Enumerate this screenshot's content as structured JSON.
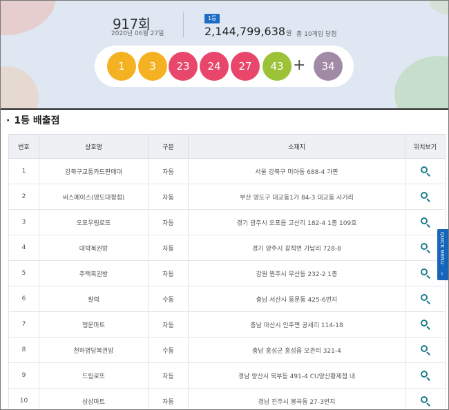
{
  "draw": {
    "round": "917회",
    "date": "2020년 06월 27일",
    "rank_badge": "1등",
    "prize_amount": "2,144,799,638",
    "prize_unit": "원",
    "winner_summary": "총 10게임 당첨",
    "numbers": [
      "1",
      "3",
      "23",
      "24",
      "27",
      "43"
    ],
    "plus": "+",
    "bonus": "34",
    "ball_colors": [
      "#f4b223",
      "#f4b223",
      "#e8466a",
      "#e8466a",
      "#e8466a",
      "#9cc238"
    ],
    "bonus_color": "#a08aa6"
  },
  "section": {
    "bullet": "·",
    "title": "1등 배출점"
  },
  "table": {
    "headers": [
      "번호",
      "상호명",
      "구분",
      "소재지",
      "위치보기"
    ],
    "rows": [
      {
        "no": "1",
        "name": "강북구교통카드판매대",
        "type": "자동",
        "address": "서울 강북구 미아동 688-4 가판"
      },
      {
        "no": "2",
        "name": "씨스페이스(영도대평점)",
        "type": "자동",
        "address": "부산 영도구 대교동1가 84-3 대교동 사거리"
      },
      {
        "no": "3",
        "name": "오포우림로또",
        "type": "자동",
        "address": "경기 광주시 오포읍 고산리 182-4 1층 109호"
      },
      {
        "no": "4",
        "name": "대박복권방",
        "type": "자동",
        "address": "경기 양주시 광적면 가납리 728-8"
      },
      {
        "no": "5",
        "name": "주택복권방",
        "type": "자동",
        "address": "강원 원주시 우산동 232-2 1층"
      },
      {
        "no": "6",
        "name": "활력",
        "type": "수동",
        "address": "충남 서산시 동문동 425-6번지"
      },
      {
        "no": "7",
        "name": "행운마트",
        "type": "자동",
        "address": "충남 아산시 인주면 공세리 114-18"
      },
      {
        "no": "8",
        "name": "천하명당복권방",
        "type": "수동",
        "address": "충남 홍성군 홍성읍 오관리 321-4"
      },
      {
        "no": "9",
        "name": "드림로또",
        "type": "자동",
        "address": "경남 양산시 북부동 491-4 CU양산황제점 내"
      },
      {
        "no": "10",
        "name": "삼삼마트",
        "type": "자동",
        "address": "경남 진주시 봉곡동 27-3번지"
      }
    ],
    "map_icon": "search-icon"
  },
  "quick_menu": {
    "label": "QUICK MENU",
    "arrow": "‹"
  }
}
